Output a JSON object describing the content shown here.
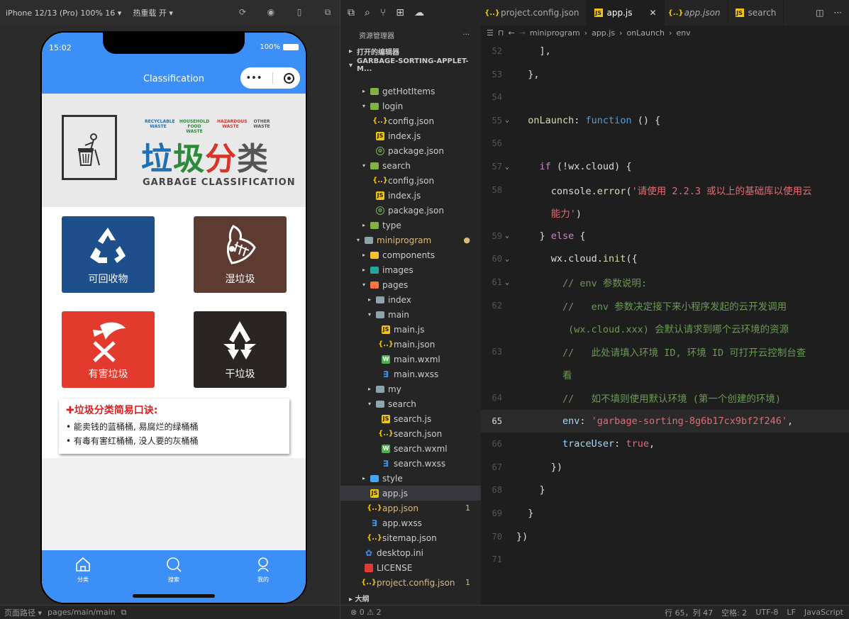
{
  "simulator": {
    "device": "iPhone 12/13 (Pro) 100% 16 ▾",
    "hot_reload": "热重载 开 ▾",
    "status_time": "15:02",
    "battery": "100%",
    "nav_title": "Classification",
    "capsule_dots": "•••",
    "banner": {
      "categories": [
        "RECYCLABLE WASTE",
        "HOUSEHOLD FOOD WASTE",
        "HAZARDOUS WASTE",
        "OTHER WASTE"
      ],
      "title_chars": [
        "垃",
        "圾",
        "分",
        "类"
      ],
      "subtitle": "GARBAGE CLASSIFICATION"
    },
    "tiles": [
      {
        "label": "可回收物",
        "color": "#1e4e8c"
      },
      {
        "label": "湿垃圾",
        "color": "#5d3b30"
      },
      {
        "label": "有害垃圾",
        "color": "#e23b2e"
      },
      {
        "label": "干垃圾",
        "color": "#2a2522"
      }
    ],
    "tips": {
      "heading": "✚垃圾分类简易口诀:",
      "lines": [
        "• 能卖钱的蓝桶桶, 易腐烂的绿桶桶",
        "• 有毒有害红桶桶, 没人要的灰桶桶"
      ]
    },
    "tabbar": [
      "分类",
      "搜索",
      "我的"
    ],
    "footer_path_label": "页面路径 ▾",
    "footer_path": "pages/main/main"
  },
  "explorer": {
    "title": "资源管理器",
    "more": "···",
    "open_editors": "打开的编辑器",
    "project": "GARBAGE-SORTING-APPLET-M...",
    "outline": "大纲",
    "status": "⊗ 0 ⚠ 2",
    "tree": [
      {
        "name": "getHotItems",
        "indent": 1,
        "arrow": "▸",
        "icon": "gfold"
      },
      {
        "name": "login",
        "indent": 1,
        "arrow": "▾",
        "icon": "gfold"
      },
      {
        "name": "config.json",
        "indent": 2,
        "arrow": "",
        "icon": "json"
      },
      {
        "name": "index.js",
        "indent": 2,
        "arrow": "",
        "icon": "js"
      },
      {
        "name": "package.json",
        "indent": 2,
        "arrow": "",
        "icon": "pkg"
      },
      {
        "name": "search",
        "indent": 1,
        "arrow": "▾",
        "icon": "gfold"
      },
      {
        "name": "config.json",
        "indent": 2,
        "arrow": "",
        "icon": "json"
      },
      {
        "name": "index.js",
        "indent": 2,
        "arrow": "",
        "icon": "js"
      },
      {
        "name": "package.json",
        "indent": 2,
        "arrow": "",
        "icon": "pkg"
      },
      {
        "name": "type",
        "indent": 1,
        "arrow": "▸",
        "icon": "gfold"
      },
      {
        "name": "miniprogram",
        "indent": 0,
        "arrow": "▾",
        "icon": "fold",
        "color": "#d7ba7d",
        "badge": "●"
      },
      {
        "name": "components",
        "indent": 1,
        "arrow": "▸",
        "icon": "yfold"
      },
      {
        "name": "images",
        "indent": 1,
        "arrow": "▸",
        "icon": "cfold"
      },
      {
        "name": "pages",
        "indent": 1,
        "arrow": "▾",
        "icon": "ofold"
      },
      {
        "name": "index",
        "indent": 2,
        "arrow": "▸",
        "icon": "fold"
      },
      {
        "name": "main",
        "indent": 2,
        "arrow": "▾",
        "icon": "fold"
      },
      {
        "name": "main.js",
        "indent": 3,
        "arrow": "",
        "icon": "js"
      },
      {
        "name": "main.json",
        "indent": 3,
        "arrow": "",
        "icon": "json"
      },
      {
        "name": "main.wxml",
        "indent": 3,
        "arrow": "",
        "icon": "wxml"
      },
      {
        "name": "main.wxss",
        "indent": 3,
        "arrow": "",
        "icon": "wxss"
      },
      {
        "name": "my",
        "indent": 2,
        "arrow": "▸",
        "icon": "fold"
      },
      {
        "name": "search",
        "indent": 2,
        "arrow": "▾",
        "icon": "fold"
      },
      {
        "name": "search.js",
        "indent": 3,
        "arrow": "",
        "icon": "js"
      },
      {
        "name": "search.json",
        "indent": 3,
        "arrow": "",
        "icon": "json"
      },
      {
        "name": "search.wxml",
        "indent": 3,
        "arrow": "",
        "icon": "wxml"
      },
      {
        "name": "search.wxss",
        "indent": 3,
        "arrow": "",
        "icon": "wxss"
      },
      {
        "name": "style",
        "indent": 1,
        "arrow": "▸",
        "icon": "bfold"
      },
      {
        "name": "app.js",
        "indent": 1,
        "arrow": "",
        "icon": "js",
        "selected": true
      },
      {
        "name": "app.json",
        "indent": 1,
        "arrow": "",
        "icon": "json",
        "color": "#d7ba7d",
        "badge": "1"
      },
      {
        "name": "app.wxss",
        "indent": 1,
        "arrow": "",
        "icon": "wxss"
      },
      {
        "name": "sitemap.json",
        "indent": 1,
        "arrow": "",
        "icon": "json"
      },
      {
        "name": "desktop.ini",
        "indent": 0,
        "arrow": "",
        "icon": "gear"
      },
      {
        "name": "LICENSE",
        "indent": 0,
        "arrow": "",
        "icon": "lic"
      },
      {
        "name": "project.config.json",
        "indent": 0,
        "arrow": "",
        "icon": "json",
        "color": "#d7ba7d",
        "badge": "1"
      }
    ]
  },
  "editor": {
    "tabs": [
      {
        "name": "project.config.json",
        "icon": "json",
        "italic": false,
        "active": false
      },
      {
        "name": "app.js",
        "icon": "js",
        "italic": false,
        "active": true
      },
      {
        "name": "app.json",
        "icon": "json",
        "italic": true,
        "active": false
      },
      {
        "name": "search",
        "icon": "js",
        "italic": false,
        "active": false
      }
    ],
    "breadcrumb": [
      "miniprogram",
      "app.js",
      "onLaunch",
      "env"
    ],
    "lines": [
      {
        "n": "52",
        "html": "<span>    ],</span>"
      },
      {
        "n": "53",
        "html": "<span>  },</span>"
      },
      {
        "n": "54",
        "html": ""
      },
      {
        "n": "55",
        "fold": true,
        "html": "<span class='fn'>  onLaunch</span><span>: </span><span class='kw'>function</span><span> () {</span>"
      },
      {
        "n": "56",
        "html": ""
      },
      {
        "n": "57",
        "fold": true,
        "html": "<span class='k'>    if</span><span> (!wx.cloud) {</span>"
      },
      {
        "n": "58",
        "html": "<span>      console.</span><span class='fn'>error</span><span>(</span><span class='str'>'请使用 2.2.3 或以上的基础库以使用云</span>"
      },
      {
        "n": "",
        "html": "<span class='str'>      能力'</span><span>)</span>"
      },
      {
        "n": "59",
        "fold": true,
        "html": "<span>    } </span><span class='k'>else</span><span> {</span>"
      },
      {
        "n": "60",
        "fold": true,
        "html": "<span>      wx.cloud.</span><span class='fn'>init</span><span>({</span>"
      },
      {
        "n": "61",
        "fold": true,
        "html": "<span class='cm'>        // env 参数说明:</span>"
      },
      {
        "n": "62",
        "html": "<span class='cm'>        //   env 参数决定接下来小程序发起的云开发调用</span>"
      },
      {
        "n": "",
        "html": "<span class='cm'>         (wx.cloud.xxx) 会默认请求到哪个云环境的资源</span>"
      },
      {
        "n": "63",
        "html": "<span class='cm'>        //   此处请填入环境 ID, 环境 ID 可打开云控制台查</span>"
      },
      {
        "n": "",
        "html": "<span class='cm'>        看</span>"
      },
      {
        "n": "64",
        "html": "<span class='cm'>        //   如不填则使用默认环境 (第一个创建的环境)</span>"
      },
      {
        "n": "65",
        "cur": true,
        "html": "<span class='prop'>        env</span><span>: </span><span class='str'>'garbage-sorting-8g6b17cx9bf2f246'</span><span>,</span>"
      },
      {
        "n": "66",
        "html": "<span class='prop'>        traceUser</span><span>: </span><span class='bool'>true</span><span>,</span>"
      },
      {
        "n": "67",
        "html": "<span>      })</span>"
      },
      {
        "n": "68",
        "html": "<span>    }</span>"
      },
      {
        "n": "69",
        "html": "<span>  }</span>"
      },
      {
        "n": "70",
        "html": "<span>})</span>"
      },
      {
        "n": "71",
        "html": ""
      }
    ],
    "status": [
      "行 65，列 47",
      "空格: 2",
      "UTF-8",
      "LF",
      "JavaScript"
    ]
  }
}
